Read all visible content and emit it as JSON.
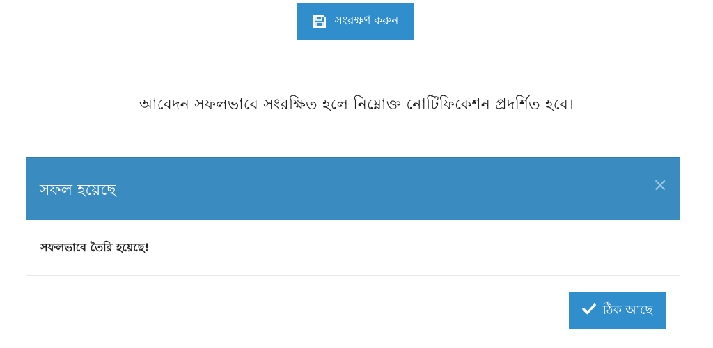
{
  "toolbar": {
    "save_label": "সংরক্ষণ করুন",
    "save_icon": "floppy-disk-icon"
  },
  "instruction_text": "আবেদন সফলভাবে সংরক্ষিত হলে নিম্নোক্ত নোটিফিকেশন প্রদর্শিত হবে।",
  "modal": {
    "title": "সফল হয়েছে",
    "close_glyph": "×",
    "message": "সফলভাবে তৈরি হয়েছে!",
    "ok_label": "ঠিক আছে",
    "ok_icon": "checkmark-icon"
  },
  "colors": {
    "button_blue": "#2f8ecb",
    "header_blue": "#3a8bbf",
    "text_dark": "#1e1e1e"
  }
}
